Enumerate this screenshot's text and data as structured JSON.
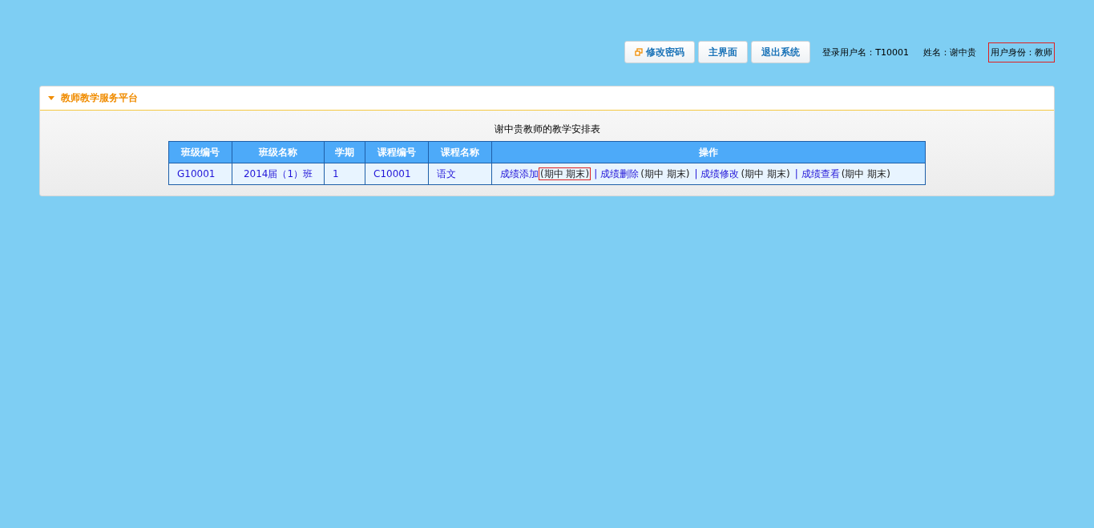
{
  "top_bar": {
    "buttons": [
      {
        "kind": "icon",
        "label": "修改密码"
      },
      {
        "kind": "plain",
        "label": "主界面"
      },
      {
        "kind": "plain",
        "label": "退出系统"
      }
    ],
    "user_info": [
      {
        "text": "登录用户名：T10001",
        "highlighted": false
      },
      {
        "text": "姓名：谢中贵",
        "highlighted": false
      },
      {
        "text": "用户身份：教师",
        "highlighted": true
      }
    ]
  },
  "panel": {
    "title": "教师教学服务平台",
    "expanded": true,
    "table_title": "谢中贵教师的教学安排表",
    "table": {
      "columns": [
        "班级编号",
        "班级名称",
        "学期",
        "课程编号",
        "课程名称",
        "操作"
      ],
      "rows": [
        {
          "cells": [
            "G10001",
            "2014届（1）班",
            "1",
            "C10001",
            "语文"
          ],
          "actions": [
            {
              "link": "成绩添加",
              "note": "(期中 期末)",
              "highlighted": true
            },
            {
              "separator": "|",
              "link": "成绩删除",
              "note": "(期中 期末)",
              "highlighted": false
            },
            {
              "separator": "|",
              "link": "成绩修改",
              "note": "(期中 期末)",
              "highlighted": false
            },
            {
              "separator": "|",
              "link": "成绩查看",
              "note": "(期中 期末)",
              "highlighted": false
            }
          ]
        }
      ]
    }
  }
}
